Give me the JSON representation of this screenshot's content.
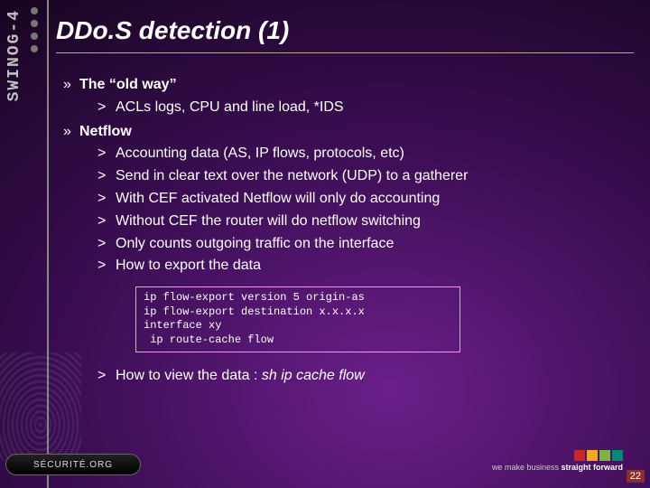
{
  "sidebar_label": "SWINOG-4",
  "title": "DDo.S detection (1)",
  "bullets": [
    {
      "label": "The “old way”",
      "items": [
        "ACLs logs, CPU and line load, *IDS"
      ]
    },
    {
      "label": "Netflow",
      "items": [
        "Accounting data (AS, IP flows, protocols, etc)",
        "Send in clear text over the network (UDP) to a gatherer",
        "With CEF activated Netflow will only do accounting",
        "Without CEF the router will do netflow switching",
        "Only counts outgoing traffic on the interface",
        "How to export the data"
      ]
    }
  ],
  "code": "ip flow-export version 5 origin-as\nip flow-export destination x.x.x.x\ninterface xy\n ip route-cache flow",
  "view_line_prefix": "How to view the data : ",
  "view_line_cmd": "sh ip cache flow",
  "footer": {
    "left_logo": "SÉCURITÉ.ORG",
    "tagline_prefix": "we make business ",
    "tagline_bold": "straight forward"
  },
  "page_number": "22"
}
